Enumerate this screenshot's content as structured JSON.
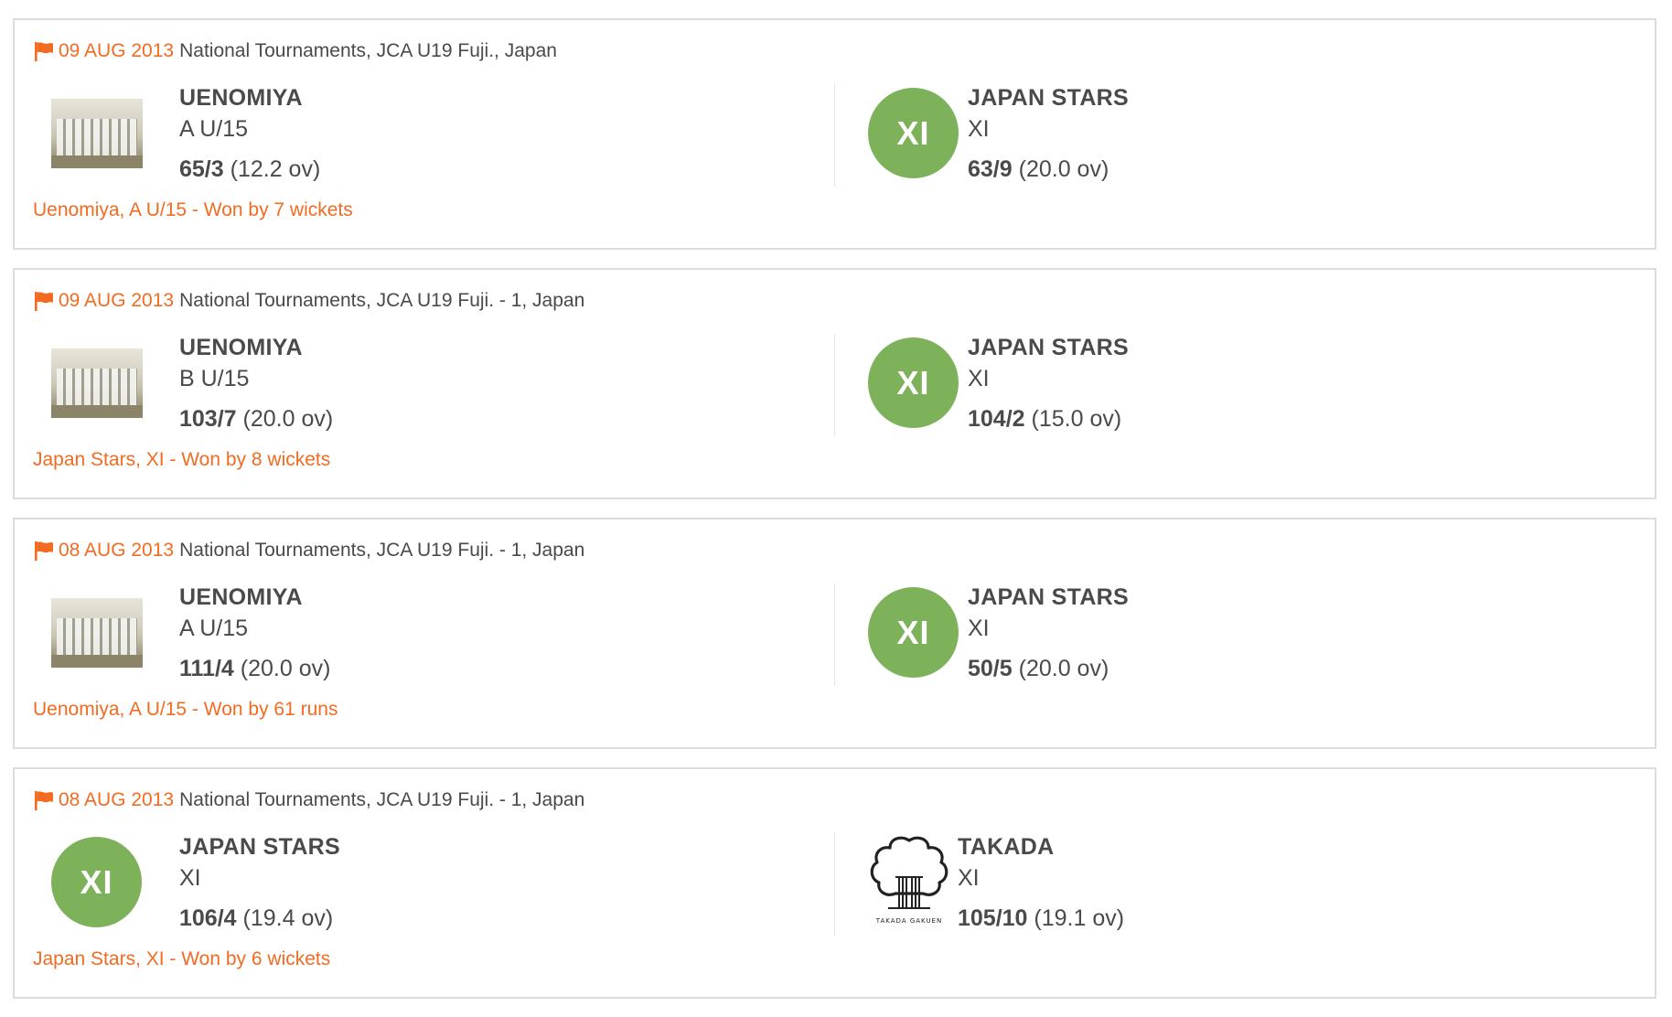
{
  "colors": {
    "accent": "#f26b21",
    "text": "#4a4a4a",
    "xi_logo": "#7db25a",
    "card_border": "#dcdcdc"
  },
  "matches": [
    {
      "date": "09 AUG 2013",
      "venue": "National Tournaments, JCA U19 Fuji., Japan",
      "home": {
        "logo": "team-photo",
        "name": "UENOMIYA",
        "sub": "A U/15",
        "runs": "65/3",
        "overs": "(12.2 ov)"
      },
      "away": {
        "logo": "xi-badge",
        "logo_text": "XI",
        "name": "JAPAN STARS",
        "sub": "XI",
        "runs": "63/9",
        "overs": "(20.0 ov)"
      },
      "result": "Uenomiya, A U/15 - Won by 7 wickets"
    },
    {
      "date": "09 AUG 2013",
      "venue": "National Tournaments, JCA U19 Fuji. - 1, Japan",
      "home": {
        "logo": "team-photo",
        "name": "UENOMIYA",
        "sub": "B U/15",
        "runs": "103/7",
        "overs": "(20.0 ov)"
      },
      "away": {
        "logo": "xi-badge",
        "logo_text": "XI",
        "name": "JAPAN STARS",
        "sub": "XI",
        "runs": "104/2",
        "overs": "(15.0 ov)"
      },
      "result": "Japan Stars, XI - Won by 8 wickets"
    },
    {
      "date": "08 AUG 2013",
      "venue": "National Tournaments, JCA U19 Fuji. - 1, Japan",
      "home": {
        "logo": "team-photo",
        "name": "UENOMIYA",
        "sub": "A U/15",
        "runs": "111/4",
        "overs": "(20.0 ov)"
      },
      "away": {
        "logo": "xi-badge",
        "logo_text": "XI",
        "name": "JAPAN STARS",
        "sub": "XI",
        "runs": "50/5",
        "overs": "(20.0 ov)"
      },
      "result": "Uenomiya, A U/15 - Won by 61 runs"
    },
    {
      "date": "08 AUG 2013",
      "venue": "National Tournaments, JCA U19 Fuji. - 1, Japan",
      "home": {
        "logo": "xi-badge",
        "logo_text": "XI",
        "name": "JAPAN STARS",
        "sub": "XI",
        "runs": "106/4",
        "overs": "(19.4 ov)"
      },
      "away": {
        "logo": "tree-emblem",
        "logo_text": "TAKADA GAKUEN",
        "name": "TAKADA",
        "sub": "XI",
        "runs": "105/10",
        "overs": "(19.1 ov)"
      },
      "result": "Japan Stars, XI - Won by 6 wickets"
    }
  ]
}
